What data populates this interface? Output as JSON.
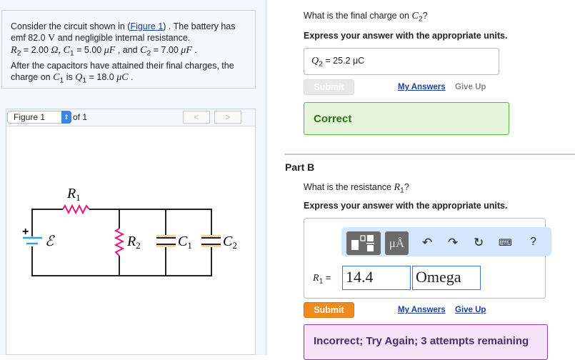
{
  "problem": {
    "t1": "Consider the circuit shown in (",
    "link": "Figure 1",
    "t2": ") . The battery has",
    "t3": "emf 82.0 ",
    "v": "V",
    "t4": " and negligible internal resistance.",
    "r2": "R",
    "r2sub": "2",
    "r2val": " = 2.00 ",
    "ohm": "Ω",
    "c1": ", C",
    "c1sub": "1",
    "c1val": " = 5.00 ",
    "uf": "μF",
    "and": " , and ",
    "c2": "C",
    "c2sub": "2",
    "c2val": " = 7.00 ",
    "uf2": "μF",
    "dot": " .",
    "t5": "After the capacitors have attained their final charges, the",
    "t6": "charge on ",
    "c1b": "C",
    "c1bsub": "1",
    "is": " is ",
    "q1": "Q",
    "q1sub": "1",
    "q1val": " = 18.0 ",
    "uc": "μC",
    "dot2": " ."
  },
  "figure": {
    "selected": "Figure 1",
    "of": "of 1",
    "prev": "<",
    "next": ">",
    "labels": {
      "r1": "R",
      "r1sub": "1",
      "emf": "ℰ",
      "plus": "+",
      "r2": "R",
      "r2sub": "2",
      "c1": "C",
      "c1sub": "1",
      "c2": "C",
      "c2sub": "2"
    },
    "colors": {
      "resistor": "#e6197e",
      "battery": "#2aa7df",
      "capacitor": "#f5d68a"
    }
  },
  "partA": {
    "question": "What is the final charge on ",
    "qvar": "C",
    "qsub": "2",
    "qmark": "?",
    "instr": "Express your answer with the appropriate units.",
    "ans_label": "Q",
    "ans_sub": "2",
    "ans_eq": " = ",
    "answer": "25.2 μC",
    "submit": "Submit",
    "my_answers": "My Answers",
    "give_up": "Give Up",
    "feedback": "Correct"
  },
  "partB": {
    "title": "Part B",
    "question": "What is the resistance ",
    "qvar": "R",
    "qsub": "1",
    "qmark": "?",
    "instr": "Express your answer with the appropriate units.",
    "toolbar": {
      "units": "μÅ",
      "help": "?"
    },
    "label": "R",
    "label_sub": "1",
    "eq": " = ",
    "value": "14.4",
    "unit": "Omega",
    "submit": "Submit",
    "my_answers": "My Answers",
    "give_up": "Give Up",
    "feedback": "Incorrect; Try Again; 3 attempts remaining"
  }
}
